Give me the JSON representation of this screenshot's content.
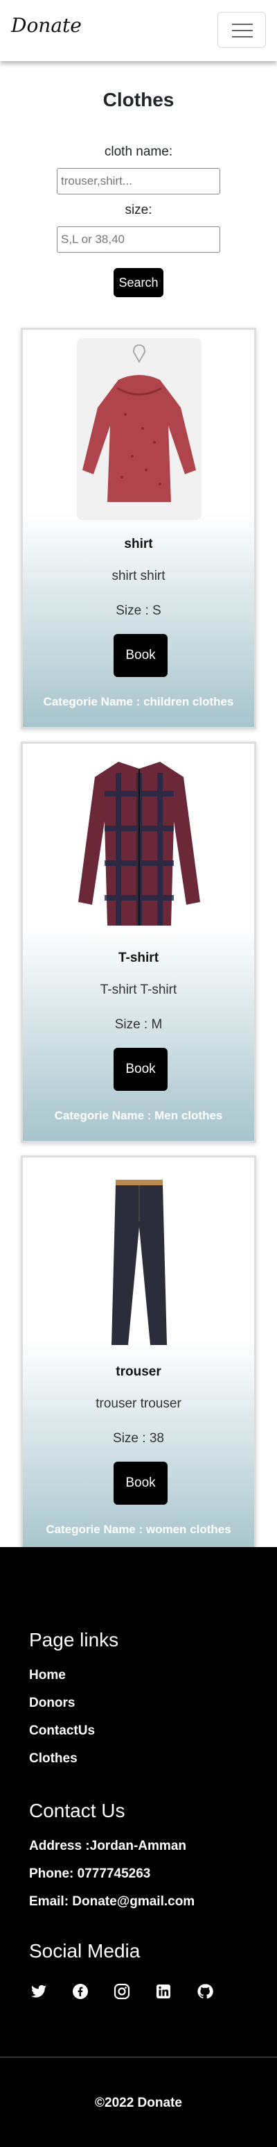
{
  "navbar": {
    "brand": "Donate",
    "toggle_icon": "menu-icon"
  },
  "search": {
    "title": "Clothes",
    "name_label": "cloth name:",
    "name_placeholder": "trouser,shirt...",
    "size_label": "size:",
    "size_placeholder": "S,L or 38,40",
    "button": "Search"
  },
  "cards": [
    {
      "title": "shirt",
      "desc": "shirt shirt",
      "size": "Size : S",
      "book": "Book",
      "category": "Categorie Name : children clothes",
      "image_icon": "blouse-image"
    },
    {
      "title": "T-shirt",
      "desc": "T-shirt T-shirt",
      "size": "Size : M",
      "book": "Book",
      "category": "Categorie Name : Men clothes",
      "image_icon": "plaid-shirt-image"
    },
    {
      "title": "trouser",
      "desc": "trouser trouser",
      "size": "Size : 38",
      "book": "Book",
      "category": "Categorie Name : women clothes",
      "image_icon": "trousers-image"
    }
  ],
  "footer": {
    "page_links_title": "Page links",
    "page_links": [
      "Home",
      "Donors",
      "ContactUs",
      "Clothes"
    ],
    "contact_title": "Contact Us",
    "address": "Address :Jordan-Amman",
    "phone": "Phone: 0777745263",
    "email": "Email: Donate@gmail.com",
    "social_title": "Social Media",
    "social_icons": [
      "twitter-icon",
      "facebook-icon",
      "instagram-icon",
      "linkedin-icon",
      "github-icon"
    ],
    "copyright": "©2022 Donate"
  },
  "colors": {
    "card_gradient_end": "#a7c4cc",
    "footer_bg": "#000000",
    "button_bg": "#000000"
  }
}
